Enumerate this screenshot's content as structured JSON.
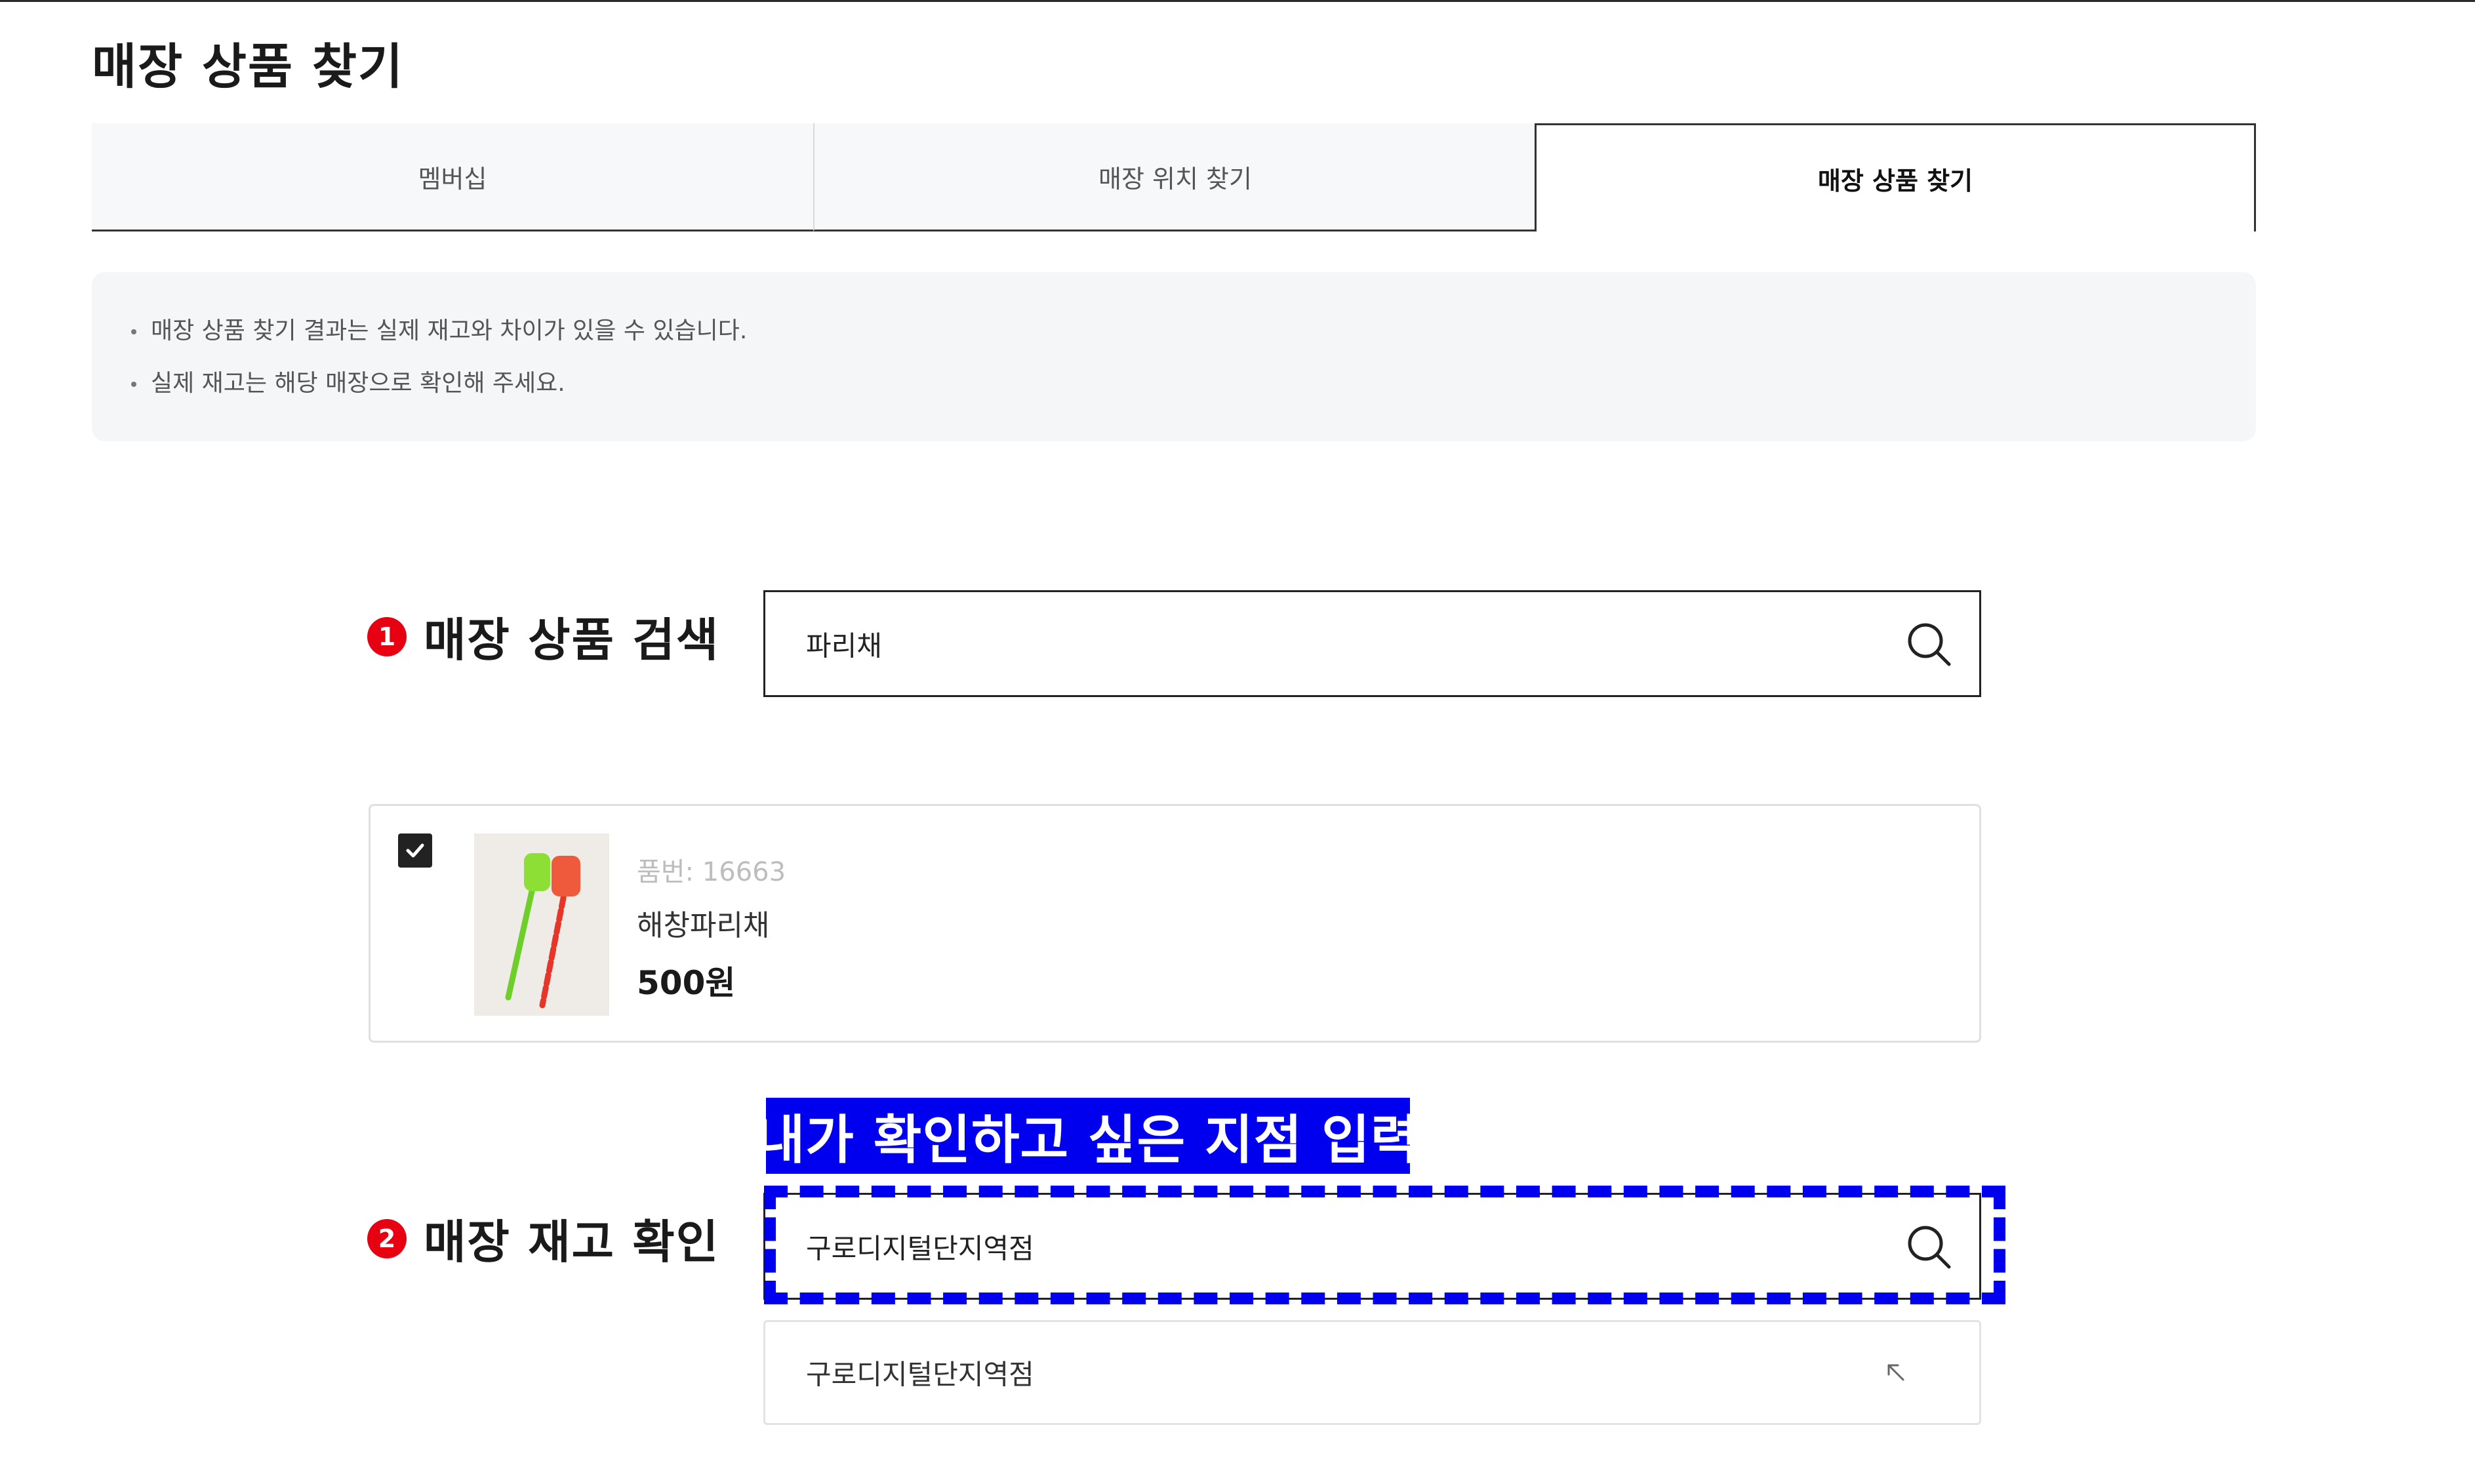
{
  "page": {
    "title": "매장 상품 찾기"
  },
  "tabs": [
    {
      "label": "멤버십",
      "active": false
    },
    {
      "label": "매장 위치 찾기",
      "active": false
    },
    {
      "label": "매장 상품 찾기",
      "active": true
    }
  ],
  "notice": [
    "매장 상품 찾기 결과는 실제 재고와 차이가 있을 수 있습니다.",
    "실제 재고는 해당 매장으로 확인해 주세요."
  ],
  "step1": {
    "number": "1",
    "label": "매장 상품 검색",
    "search_value": "파리채",
    "icon": "search-icon"
  },
  "product": {
    "checked": true,
    "code": "품번: 16663",
    "name": "해창파리채",
    "price": "500원"
  },
  "annotation": {
    "text": "내가 확인하고 싶은 지점 입력",
    "color": "#0000ee"
  },
  "step2": {
    "number": "2",
    "label": "매장 재고 확인",
    "search_value": "구로디지털단지역점",
    "icon": "search-icon"
  },
  "suggestion": {
    "text": "구로디지털단지역점",
    "icon": "arrow-up-left-icon"
  },
  "colors": {
    "accent": "#e60012",
    "annotation": "#0000ee"
  }
}
